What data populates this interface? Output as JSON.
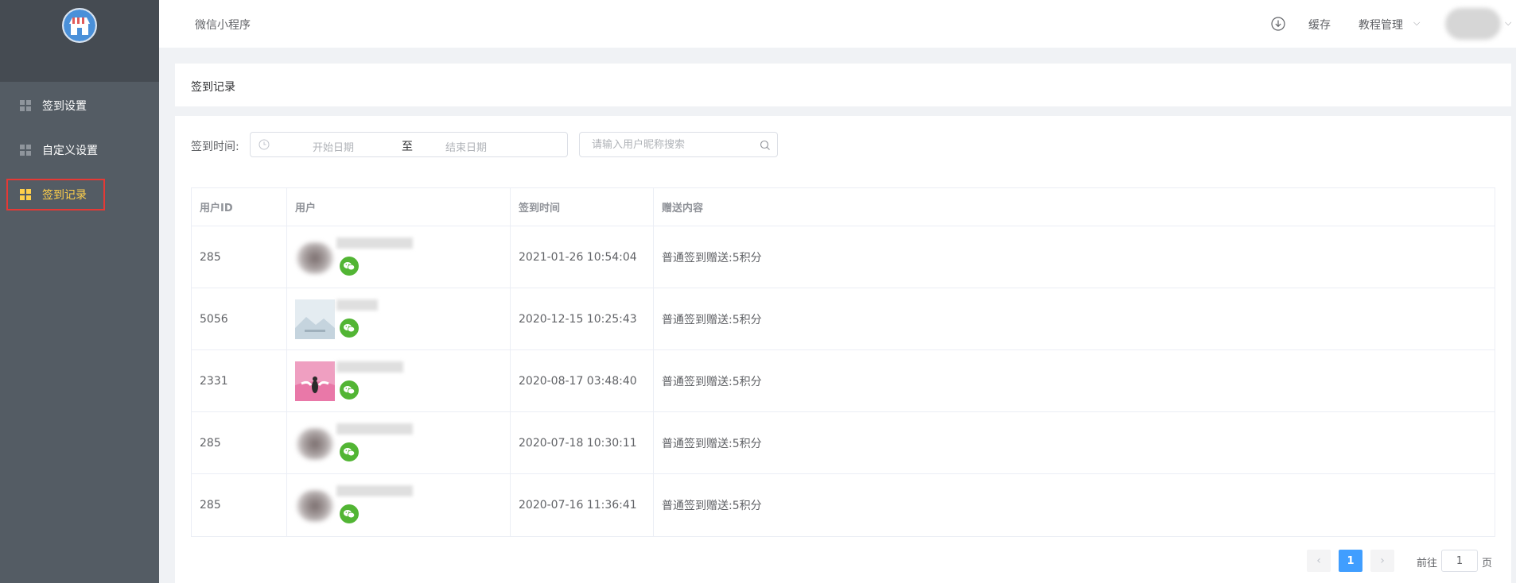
{
  "sidebar": {
    "items": [
      {
        "label": "签到设置"
      },
      {
        "label": "自定义设置"
      },
      {
        "label": "签到记录"
      }
    ]
  },
  "header": {
    "title": "微信小程序",
    "cache": "缓存",
    "manage": "教程管理"
  },
  "page": {
    "title": "签到记录"
  },
  "filter": {
    "label": "签到时间:",
    "start_placeholder": "开始日期",
    "separator": "至",
    "end_placeholder": "结束日期",
    "search_placeholder": "请输入用户昵称搜索"
  },
  "table": {
    "headers": [
      "用户ID",
      "用户",
      "签到时间",
      "赠送内容"
    ],
    "rows": [
      {
        "id": "285",
        "time": "2021-01-26 10:54:04",
        "content": "普通签到赠送:5积分"
      },
      {
        "id": "5056",
        "time": "2020-12-15 10:25:43",
        "content": "普通签到赠送:5积分"
      },
      {
        "id": "2331",
        "time": "2020-08-17 03:48:40",
        "content": "普通签到赠送:5积分"
      },
      {
        "id": "285",
        "time": "2020-07-18 10:30:11",
        "content": "普通签到赠送:5积分"
      },
      {
        "id": "285",
        "time": "2020-07-16 11:36:41",
        "content": "普通签到赠送:5积分"
      }
    ]
  },
  "pagination": {
    "current": "1",
    "goto_label": "前往",
    "goto_value": "1",
    "goto_suffix": "页"
  },
  "colors": {
    "sidebar_bg": "#545c64",
    "active": "#ffd04b",
    "highlight_box": "#e53935",
    "primary": "#409eff",
    "wechat": "#52b534"
  },
  "icons": {
    "logo": "store-icon",
    "download": "download-icon",
    "search": "search-icon",
    "clock": "clock-icon",
    "wechat": "wechat-icon"
  }
}
